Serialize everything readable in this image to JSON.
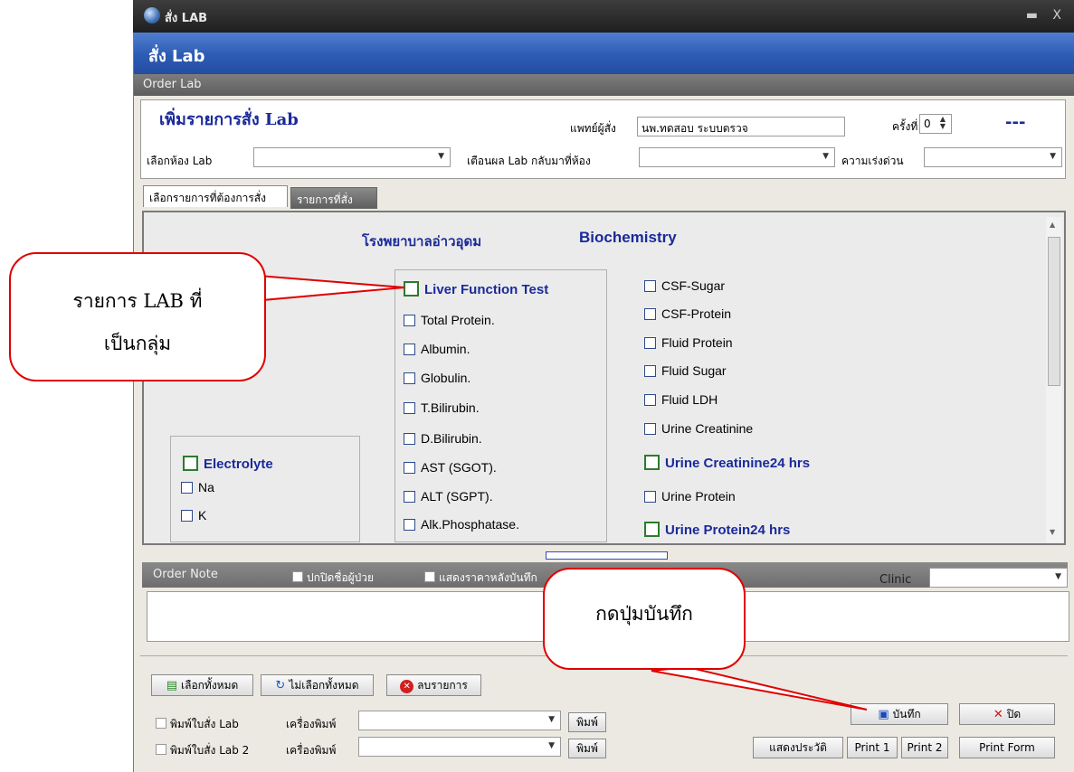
{
  "window": {
    "title": "สั่ง LAB",
    "controls": "▬ X"
  },
  "header": {
    "title": "สั่ง Lab"
  },
  "orderlab_label": "Order Lab",
  "form": {
    "heading": "เพิ่มรายการสั่ง Lab",
    "doctor_label": "แพทย์ผู้สั่ง",
    "doctor_value": "นพ.ทดสอบ ระบบตรวจ",
    "times_label": "ครั้งที่",
    "times_value": "0",
    "dashes": "---",
    "lab_room_label": "เลือกห้อง Lab",
    "lab_room_value": "",
    "return_label": "เตือนผล Lab กลับมาที่ห้อง",
    "return_value": "",
    "urgency_label": "ความเร่งด่วน",
    "urgency_value": ""
  },
  "tabs": [
    {
      "label": "เลือกรายการที่ต้องการสั่ง",
      "active": true
    },
    {
      "label": "รายการที่สั่ง",
      "active": false
    }
  ],
  "content": {
    "hospital": "โรงพยาบาลอ่าวอุดม",
    "section": "Biochemistry",
    "col_left": {
      "group": "Electrolyte",
      "items": [
        "Na",
        "K"
      ]
    },
    "col_mid": {
      "group": "Liver Function Test",
      "items": [
        "Total Protein.",
        "Albumin.",
        "Globulin.",
        "T.Bilirubin.",
        "D.Bilirubin.",
        "AST (SGOT).",
        "ALT (SGPT).",
        "Alk.Phosphatase."
      ]
    },
    "col_right": {
      "items": [
        "CSF-Sugar",
        "CSF-Protein",
        "Fluid Protein",
        "Fluid Sugar",
        "Fluid  LDH",
        "Urine Creatinine"
      ],
      "group1": "Urine Creatinine24 hrs",
      "item7": "Urine Protein",
      "group2": "Urine Protein24 hrs"
    }
  },
  "note": {
    "label": "Order Note",
    "hide_name": "ปกปิดชื่อผู้ป่วย",
    "show_price": "แสดงราคาหลังบันทึก",
    "clinic_label": "Clinic"
  },
  "bottom": {
    "select_all": "เลือกทั้งหมด",
    "deselect_all": "ไม่เลือกทั้งหมด",
    "delete": "ลบรายการ",
    "print_order": "พิมพ์ใบสั่ง Lab",
    "print_order2": "พิมพ์ใบสั่ง Lab 2",
    "printer_label": "เครื่องพิมพ์",
    "print_btn": "พิมพ์",
    "save": "บันทึก",
    "close": "ปิด",
    "history": "แสดงประวัติ",
    "print1": "Print 1",
    "print2": "Print 2",
    "print_form": "Print Form"
  },
  "callouts": {
    "group_line1": "รายการ LAB ที่",
    "group_line2": "เป็นกลุ่ม",
    "save_hint": "กดปุ่มบันทึก"
  },
  "colors": {
    "header_blue": "#2d5bb4",
    "group_text": "#1a2a9a",
    "callout_red": "#e00000"
  }
}
